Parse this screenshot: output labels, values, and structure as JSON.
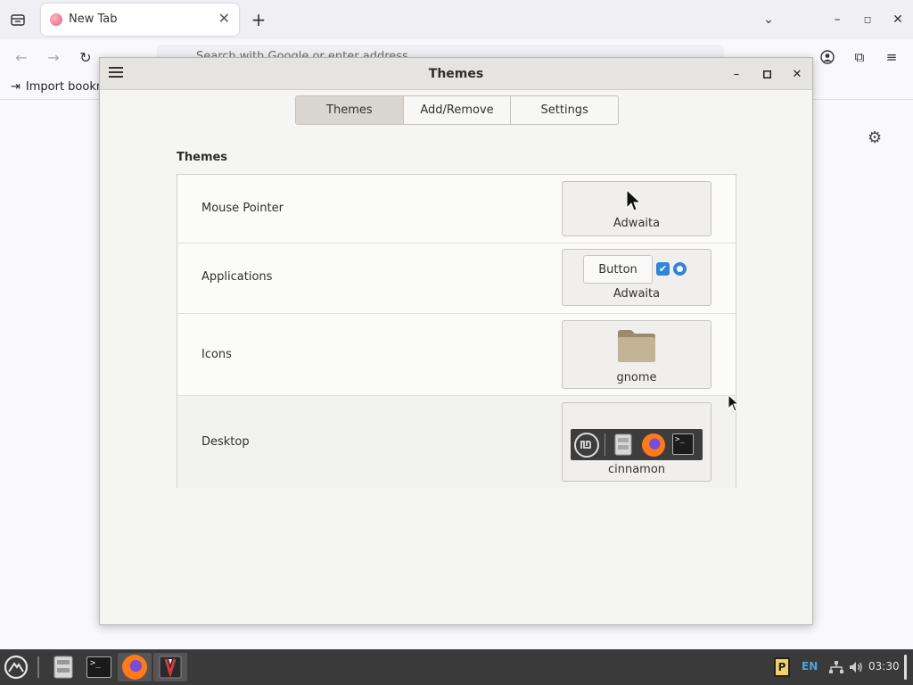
{
  "browser": {
    "tab_title": "New Tab",
    "url_placeholder": "Search with Google or enter address",
    "bookmark_label": "Import bookmarks..."
  },
  "dialog": {
    "title": "Themes",
    "tabs": [
      {
        "label": "Themes",
        "active": true
      },
      {
        "label": "Add/Remove",
        "active": false
      },
      {
        "label": "Settings",
        "active": false
      }
    ],
    "section_title": "Themes",
    "rows": [
      {
        "label": "Mouse Pointer",
        "value": "Adwaita"
      },
      {
        "label": "Applications",
        "value": "Adwaita",
        "preview_button": "Button"
      },
      {
        "label": "Icons",
        "value": "gnome"
      },
      {
        "label": "Desktop",
        "value": "cinnamon"
      }
    ]
  },
  "taskbar": {
    "language": "EN",
    "clock": "03:30"
  },
  "colors": {
    "accent": "#2f86d6",
    "titlebar": "#e6e4e0",
    "taskbar": "#3a3a3a"
  }
}
